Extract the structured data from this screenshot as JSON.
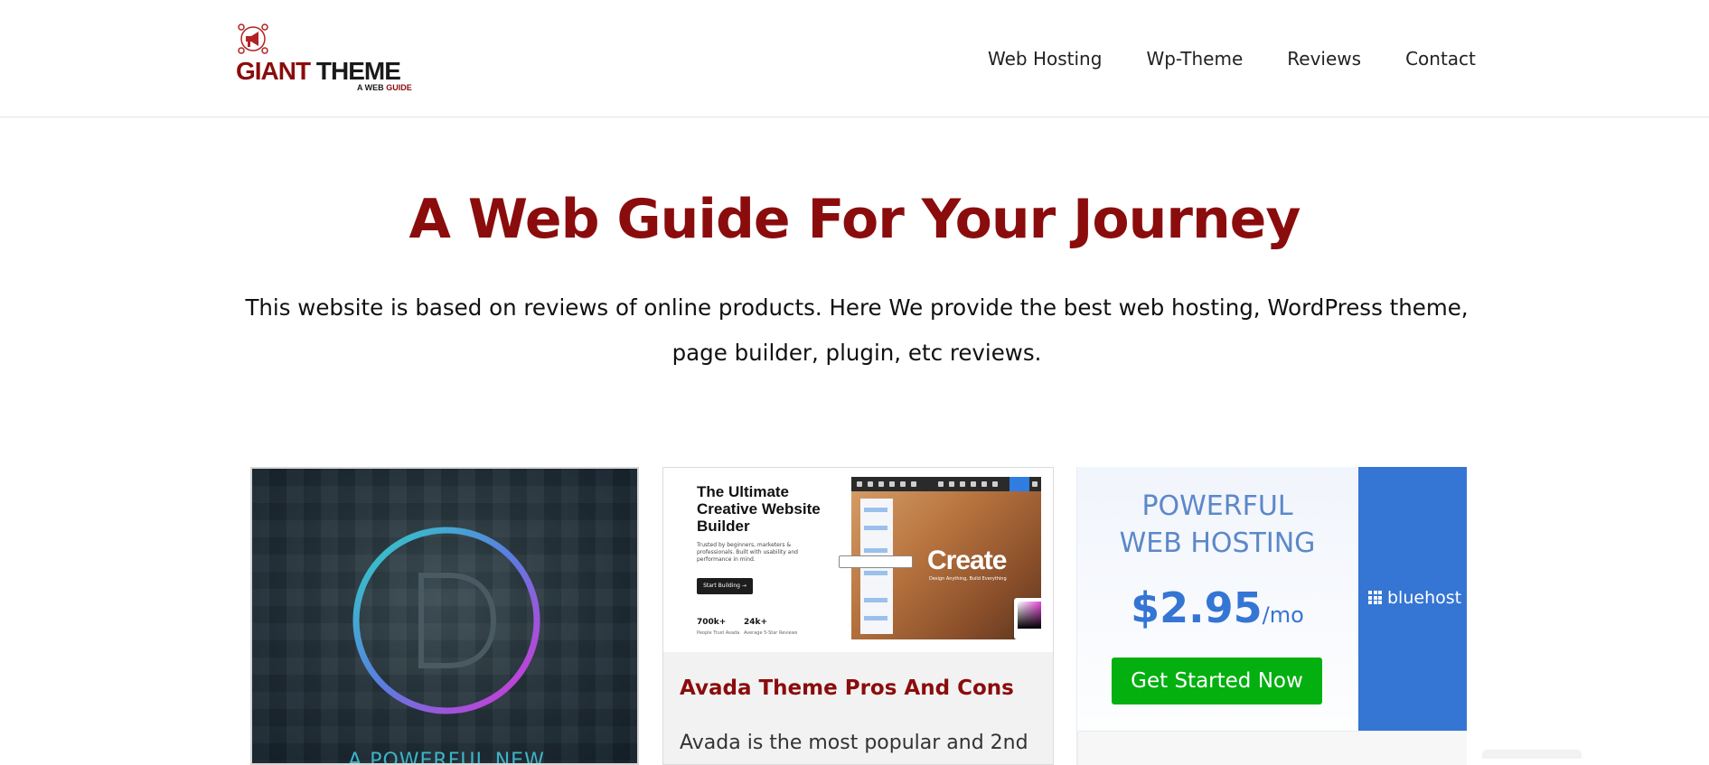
{
  "header": {
    "logo": {
      "word1": "GIANT",
      "word2": "THEME",
      "tag1": "A WEB",
      "tag2": "GUIDE"
    },
    "nav": [
      {
        "label": "Web Hosting"
      },
      {
        "label": "Wp-Theme"
      },
      {
        "label": "Reviews"
      },
      {
        "label": "Contact"
      }
    ]
  },
  "hero": {
    "title": "A Web Guide For Your Journey",
    "description": "This website is based on reviews of online products. Here We provide the best web hosting, WordPress theme, page builder, plugin, etc reviews."
  },
  "cards": {
    "divi": {
      "image_caption": "A POWERFUL NEW"
    },
    "avada": {
      "image": {
        "headline": "The Ultimate Creative Website Builder",
        "subtext": "Trusted by beginners, marketers & professionals. Built with usability and performance in mind.",
        "button": "Start Building →",
        "stat1_value": "700k+",
        "stat1_label": "People Trust Avada",
        "stat2_value": "24k+",
        "stat2_label": "Average 5-Star Reviews",
        "overlay_title": "Create",
        "overlay_sub": "Design Anything, Build Everything"
      },
      "title": "Avada Theme Pros And Cons",
      "excerpt": "Avada is the most popular and 2nd"
    },
    "bluehost": {
      "line1": "POWERFUL",
      "line2": "WEB HOSTING",
      "price": "$2.95",
      "per": "/mo",
      "cta": "Get Started Now",
      "brand": "bluehost"
    }
  },
  "colors": {
    "brand_red": "#8b0c0c",
    "bluehost_blue": "#3575d3",
    "cta_green": "#04b010"
  }
}
